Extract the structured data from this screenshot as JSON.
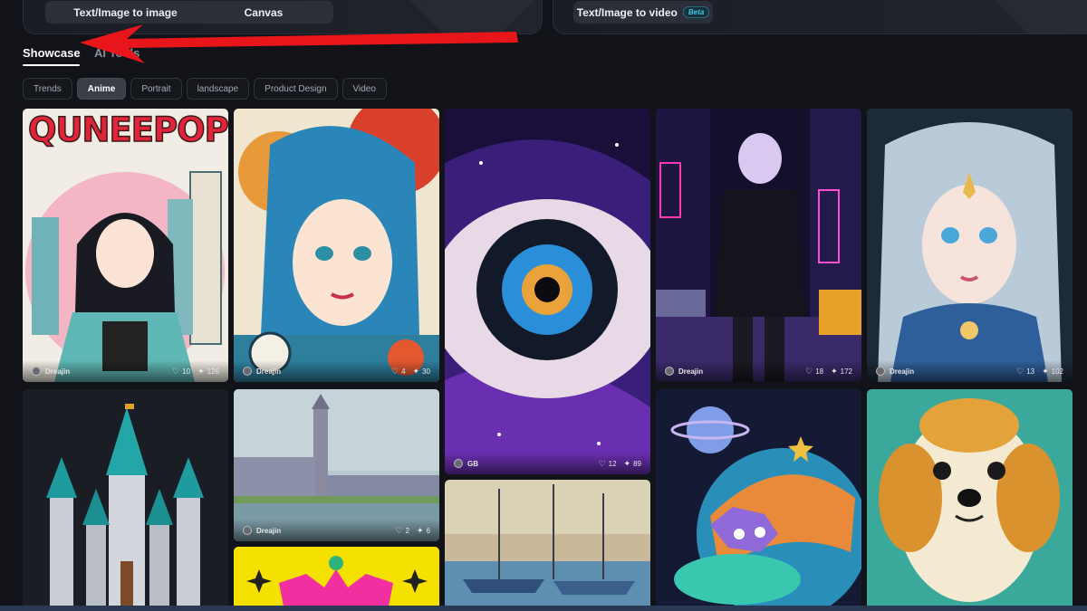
{
  "create_panel": {
    "buttons": [
      {
        "label": "Text/Image to image"
      },
      {
        "label": "Canvas"
      },
      {
        "label": "Text/Image to video",
        "badge": "Beta"
      }
    ]
  },
  "tabs": [
    {
      "label": "Showcase",
      "active": true
    },
    {
      "label": "AI Tools",
      "active": false
    }
  ],
  "filters": [
    {
      "label": "Trends",
      "active": false
    },
    {
      "label": "Anime",
      "active": true
    },
    {
      "label": "Portrait",
      "active": false
    },
    {
      "label": "landscape",
      "active": false
    },
    {
      "label": "Product Design",
      "active": false
    },
    {
      "label": "Video",
      "active": false
    }
  ],
  "gallery": [
    {
      "title": "QUNEEPOP",
      "author": "Dreajin",
      "likes": "10",
      "remixes": "126"
    },
    {
      "author": "Dreajin",
      "likes": "4",
      "remixes": "30"
    },
    {
      "author": "GB",
      "likes": "12",
      "remixes": "89"
    },
    {
      "author": "Dreajin",
      "likes": "18",
      "remixes": "172"
    },
    {
      "author": "Dreajin",
      "likes": "13",
      "remixes": "102"
    },
    {
      "author": "Dreajin",
      "likes": "2",
      "remixes": "6"
    }
  ],
  "icons": {
    "like": "heart-icon",
    "remix": "sparkle-icon"
  },
  "colors": {
    "background": "#111318",
    "beta_badge": "#48c7e6",
    "arrow": "#e8161b"
  }
}
